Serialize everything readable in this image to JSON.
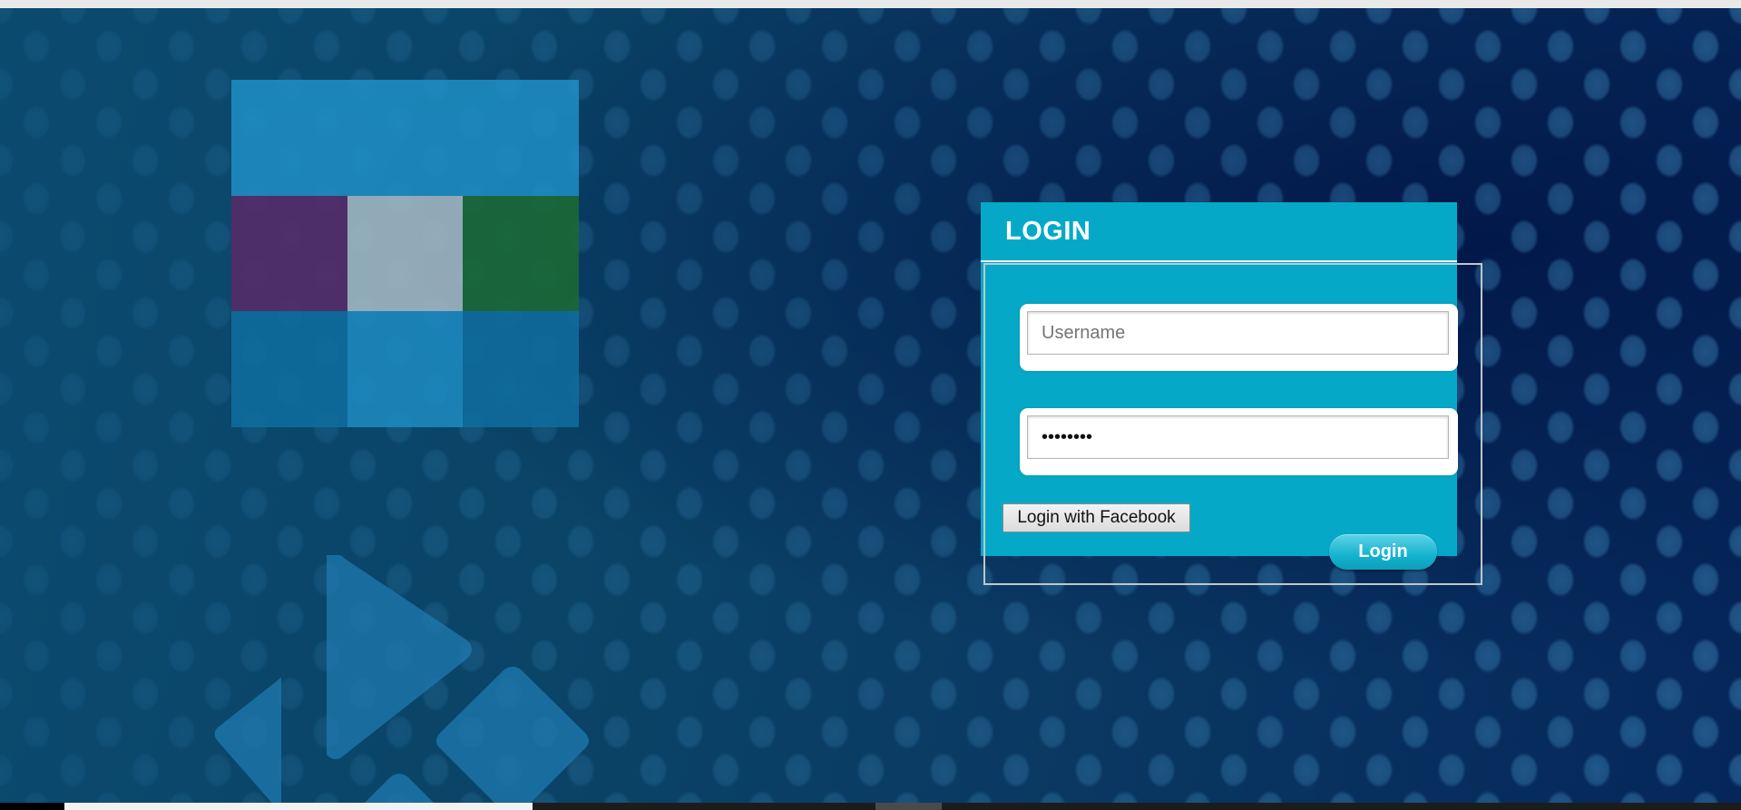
{
  "login": {
    "title": "LOGIN",
    "username_placeholder": "Username",
    "password_value": "password",
    "facebook_button_label": "Login with Facebook",
    "submit_label": "Login"
  },
  "colors": {
    "panel": "#05a9c7",
    "background": "#0a4467",
    "tile_top": "#1f8fc6",
    "tile_purple": "#5a2a68",
    "tile_gray": "#a9bcc6",
    "tile_green": "#1c6b33",
    "tile_dark_blue": "#0f6e9f",
    "tile_light_blue": "#1e8cc3",
    "kodi_logo": "#1f7ab0"
  },
  "icons": {
    "background_logo": "kodi-logo-icon",
    "tile_logo": "tile-grid-icon"
  }
}
